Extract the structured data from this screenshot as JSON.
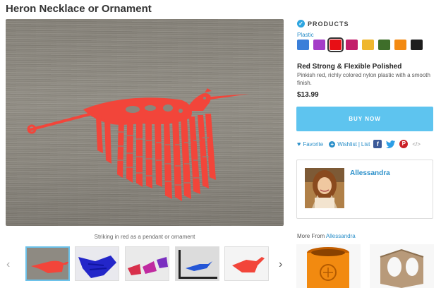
{
  "page": {
    "title": "Heron Necklace or Ornament",
    "caption": "Striking in red as a pendant or ornament"
  },
  "products": {
    "label": "PRODUCTS",
    "material": "Plastic",
    "swatches": [
      {
        "name": "blue",
        "color": "#3b7fd9"
      },
      {
        "name": "purple",
        "color": "#a43bc8"
      },
      {
        "name": "red",
        "color": "#e80f15",
        "selected": true
      },
      {
        "name": "magenta",
        "color": "#c21e6a"
      },
      {
        "name": "yellow",
        "color": "#efb72e"
      },
      {
        "name": "green",
        "color": "#3e6e2a"
      },
      {
        "name": "orange",
        "color": "#f38a12"
      },
      {
        "name": "black",
        "color": "#1e1e1e"
      }
    ],
    "selected_name": "Red Strong & Flexible Polished",
    "description": "Pinkish red, richly colored nylon plastic with a smooth finish.",
    "price": "$13.99",
    "buy_label": "BUY NOW"
  },
  "actions": {
    "favorite": "Favorite",
    "wishlist": "Wishlist",
    "list": "List"
  },
  "artist": {
    "name": "Allessandra"
  },
  "more_from": {
    "prefix": "More From",
    "artist": "Allessandra"
  },
  "colors": {
    "accent": "#2a8fc9",
    "buy_button": "#5ec4ef",
    "heron": "#f2453a"
  }
}
